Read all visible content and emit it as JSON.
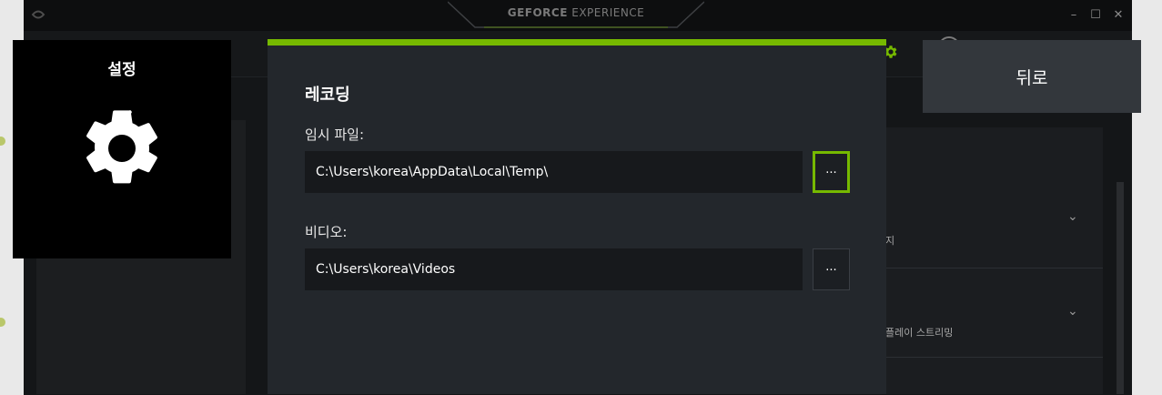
{
  "window": {
    "title_bold": "GEFORCE",
    "title_light": " EXPERIENCE",
    "controls": {
      "minimize": "–",
      "maximize": "☐",
      "close": "✕"
    }
  },
  "settings_tile": {
    "title": "설정",
    "icon": "gear-icon"
  },
  "back_button": {
    "label": "뒤로"
  },
  "dialog": {
    "heading": "레코딩",
    "temp_file": {
      "label": "임시 파일:",
      "value": "C:\\Users\\korea\\AppData\\Local\\Temp\\",
      "browse_label": "..."
    },
    "video": {
      "label": "비디오:",
      "value": "C:\\Users\\korea\\Videos",
      "browse_label": "..."
    }
  },
  "background": {
    "right_panel_row1_text": "지",
    "right_panel_row2_text": "플레이 스트리밍"
  },
  "colors": {
    "accent": "#76b900",
    "dialog_bg": "#23272c",
    "tile_bg": "#000000",
    "back_bg": "#33373c"
  }
}
